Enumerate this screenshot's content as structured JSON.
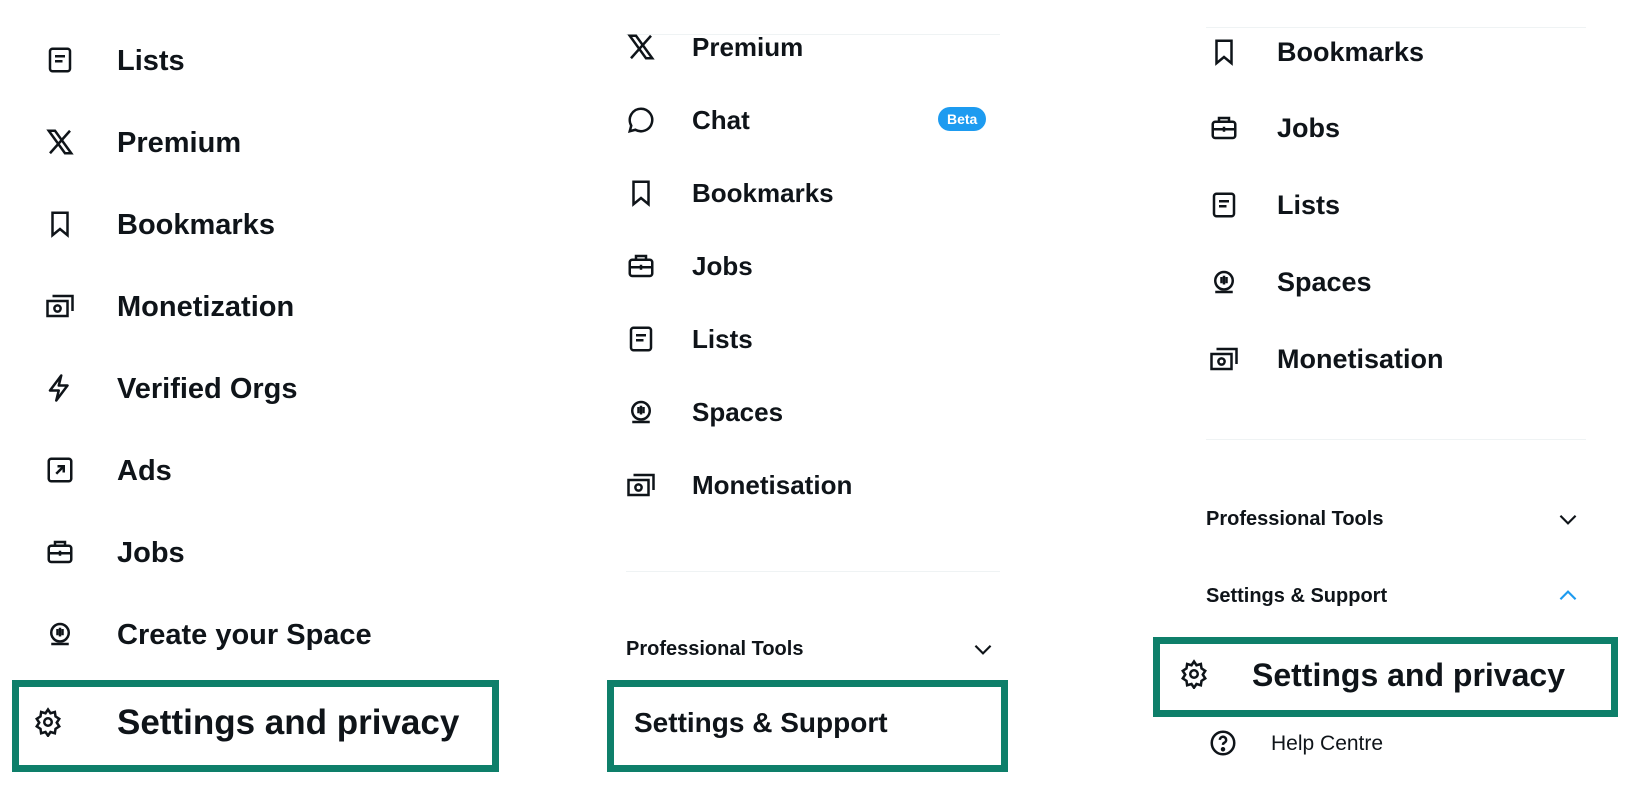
{
  "panel_left": {
    "items": [
      {
        "label": "Lists",
        "icon": "list-icon"
      },
      {
        "label": "Premium",
        "icon": "x-logo-icon"
      },
      {
        "label": "Bookmarks",
        "icon": "bookmark-icon"
      },
      {
        "label": "Monetization",
        "icon": "money-icon"
      },
      {
        "label": "Verified Orgs",
        "icon": "lightning-icon"
      },
      {
        "label": "Ads",
        "icon": "ads-arrow-icon"
      },
      {
        "label": "Jobs",
        "icon": "briefcase-icon"
      },
      {
        "label": "Create your Space",
        "icon": "spaces-icon"
      }
    ],
    "highlight": {
      "label": "Settings and privacy",
      "icon": "gear-icon"
    }
  },
  "panel_middle": {
    "items": [
      {
        "label": "Premium",
        "icon": "x-logo-icon"
      },
      {
        "label": "Chat",
        "icon": "chat-bubble-icon",
        "badge": "Beta"
      },
      {
        "label": "Bookmarks",
        "icon": "bookmark-icon"
      },
      {
        "label": "Jobs",
        "icon": "briefcase-icon"
      },
      {
        "label": "Lists",
        "icon": "list-icon"
      },
      {
        "label": "Spaces",
        "icon": "spaces-icon"
      },
      {
        "label": "Monetisation",
        "icon": "money-icon"
      }
    ],
    "professional_tools": "Professional Tools",
    "highlight": {
      "label": "Settings & Support"
    }
  },
  "panel_right": {
    "items": [
      {
        "label": "Bookmarks",
        "icon": "bookmark-icon"
      },
      {
        "label": "Jobs",
        "icon": "briefcase-icon"
      },
      {
        "label": "Lists",
        "icon": "list-icon"
      },
      {
        "label": "Spaces",
        "icon": "spaces-icon"
      },
      {
        "label": "Monetisation",
        "icon": "money-icon"
      }
    ],
    "professional_tools": "Professional Tools",
    "settings_support": "Settings & Support",
    "highlight": {
      "label": "Settings and privacy",
      "icon": "gear-icon"
    },
    "help": {
      "label": "Help Centre",
      "icon": "help-circle-icon"
    }
  },
  "colors": {
    "highlight_border": "#0e7f6a",
    "beta_badge": "#1d9bf0",
    "expanded_chevron": "#1d9bf0",
    "text": "#0f1419"
  }
}
